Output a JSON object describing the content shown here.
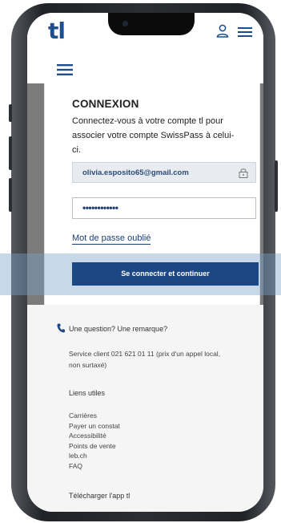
{
  "header": {
    "logo": "tl"
  },
  "login": {
    "title": "CONNEXION",
    "description": "Connectez-vous à votre compte tl pour associer votre compte SwissPass à celui-ci.",
    "email_value": "olivia.esposito65@gmail.com",
    "password_value": "••••••••••••",
    "forgot_link": "Mot de passe oublié",
    "submit_label": "Se connecter et continuer"
  },
  "footer": {
    "question": "Une question? Une remarque?",
    "service_text": "Service client 021 621 01 11 (prix d'un appel local, non surtaxé)",
    "links_heading": "Liens utiles",
    "links": [
      "Carrières",
      "Payer un constat",
      "Accessibilité",
      "Points de vente",
      "leb.ch",
      "FAQ"
    ],
    "download_label": "Télécharger l'app tl"
  },
  "colors": {
    "brand": "#1d4784",
    "logo": "#1d4e8f",
    "highlight_band": "#7aa1cb"
  },
  "icons": [
    "user-icon",
    "menu-icon",
    "lock-icon",
    "phone-icon"
  ]
}
